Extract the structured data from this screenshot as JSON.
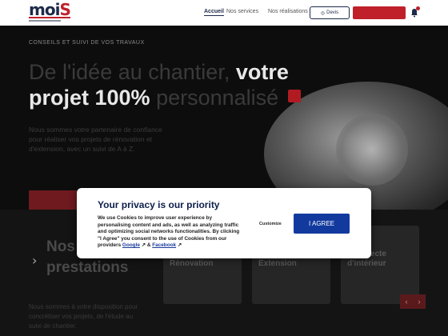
{
  "header": {
    "logo_text": "moi",
    "logo_s": "S",
    "nav": [
      "Accueil",
      "Nos services",
      "Nos réalisations"
    ],
    "quote_label": "Devis",
    "contact_label": ""
  },
  "hero": {
    "eyebrow": "CONSEILS ET SUIVI DE VOS TRAVAUX",
    "title_part1": "De l'idée au chantier, ",
    "title_bold1": "votre",
    "title_bold2": "projet 100%",
    "title_part2": " personnalisé",
    "desc": "Nous sommes votre partenaire de confiance pour réaliser vos projets de rénovation et d'extension, avec un suivi de A à Z.",
    "cta": ""
  },
  "services": {
    "title_line1": "Nos",
    "title_line2": "prestations",
    "desc": "Nous sommes à votre disposition pour concrétiser vos projets, de l'étude au suivi de chantier.",
    "cards": [
      {
        "label": "Rénovation"
      },
      {
        "label": "Extension"
      },
      {
        "label": "Architecte d'intérieur"
      }
    ]
  },
  "cookie": {
    "title": "Your privacy is our priority",
    "text_prefix": "We use Cookies to improve user experience by personalising content and ads, as well as analyzing traffic and optimizing social networks functionalities. By clicking \"I Agree\" you consent to the use of Cookies from our providers ",
    "google_link": "Google",
    "and": " & ",
    "facebook_link": "Facebook",
    "customize_label": "Customize",
    "agree_label": "I AGREE"
  },
  "colors": {
    "brand_red": "#c0202a",
    "brand_navy": "#1e2a4a",
    "agree_blue": "#123a9e"
  }
}
